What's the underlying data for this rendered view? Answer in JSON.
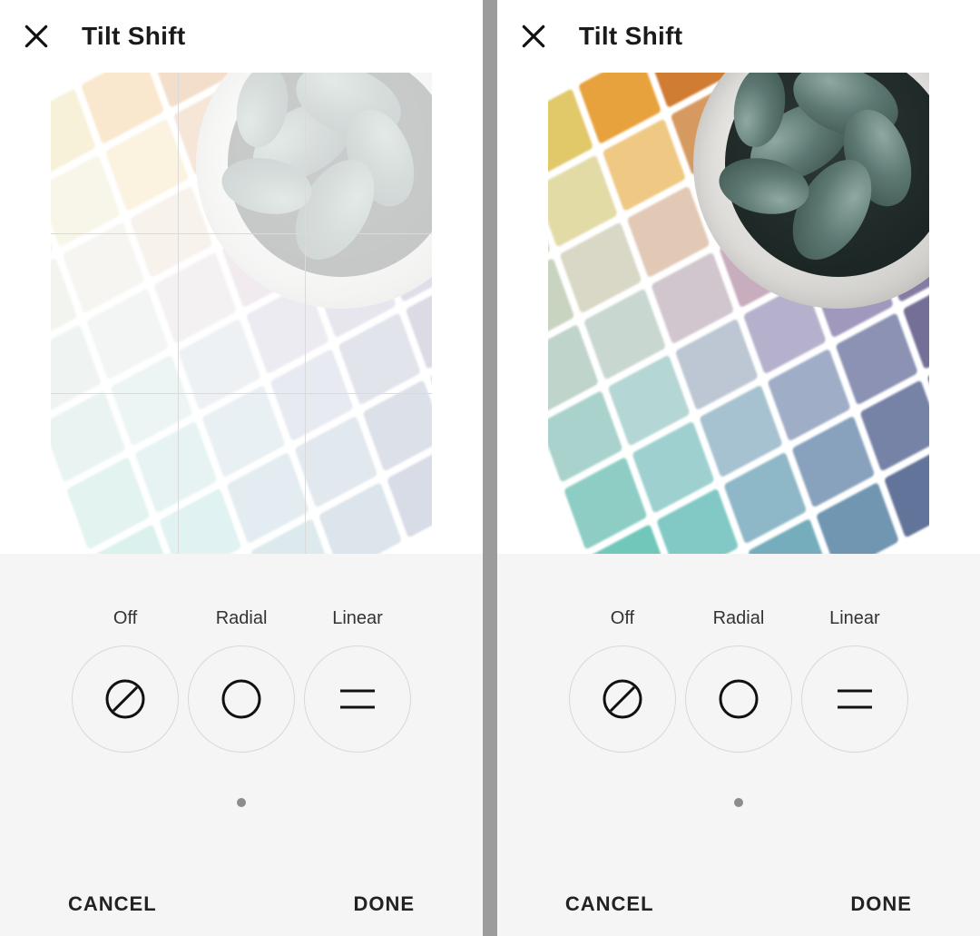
{
  "left": {
    "title": "Tilt Shift",
    "options": {
      "off": "Off",
      "radial": "Radial",
      "linear": "Linear"
    },
    "footer": {
      "cancel": "CANCEL",
      "done": "DONE"
    },
    "grid_visible": true,
    "photo_faded": true
  },
  "right": {
    "title": "Tilt Shift",
    "options": {
      "off": "Off",
      "radial": "Radial",
      "linear": "Linear"
    },
    "footer": {
      "cancel": "CANCEL",
      "done": "DONE"
    },
    "grid_visible": false,
    "photo_faded": false
  },
  "tile_colors": [
    "#b9b96a",
    "#e1c869",
    "#e8a23d",
    "#d07c33",
    "#b86c3a",
    "#8d5a3a",
    "#c9cfae",
    "#e3dba6",
    "#efc984",
    "#d69a60",
    "#be8363",
    "#9a6c5f",
    "#c9d4c0",
    "#d9d8c6",
    "#e2c9b6",
    "#d3a9a4",
    "#c08f9a",
    "#9d7e96",
    "#bfd4cb",
    "#c9d7d1",
    "#d1c6cd",
    "#c8adbf",
    "#b395b5",
    "#947fa4",
    "#a9d2cc",
    "#b4d6d4",
    "#bcc7d3",
    "#b5b1cc",
    "#a098bd",
    "#857ba3",
    "#8ecdc4",
    "#9ed0cf",
    "#a6c1cf",
    "#9fadc7",
    "#8b92b3",
    "#746f96",
    "#70c7ba",
    "#82c9c6",
    "#8eb8c7",
    "#88a2bd",
    "#7683a7",
    "#625e87",
    "#55bdad",
    "#68bfba",
    "#76adbc",
    "#7096b1",
    "#63749a",
    "#514f79"
  ]
}
